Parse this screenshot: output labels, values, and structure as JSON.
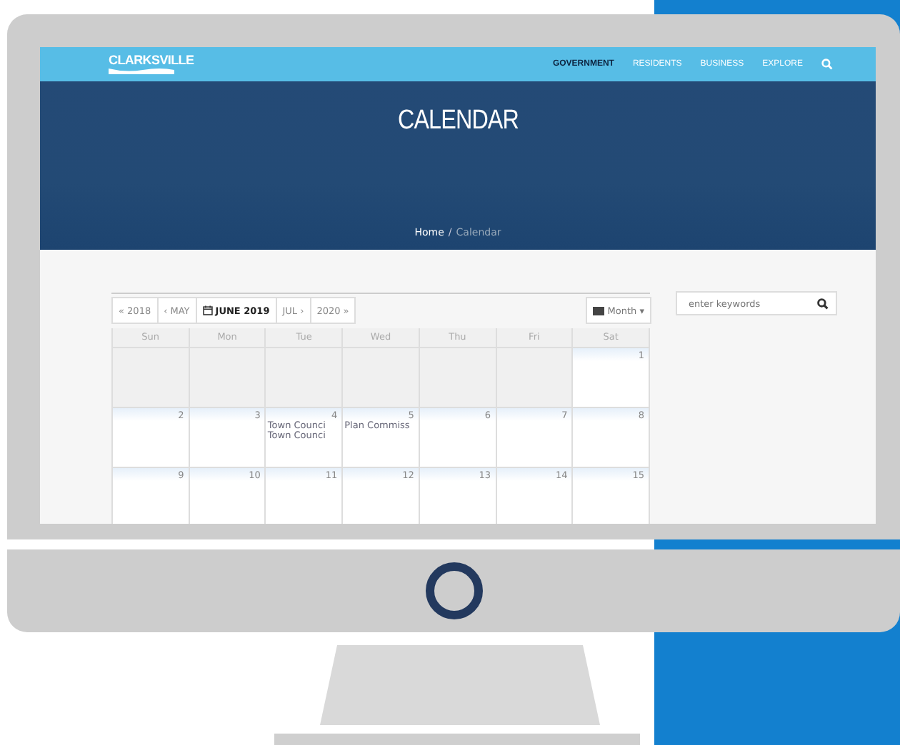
{
  "site": {
    "logo": "CLARKSVILLE",
    "nav": [
      {
        "label": "GOVERNMENT",
        "selected": true
      },
      {
        "label": "RESIDENTS",
        "selected": false
      },
      {
        "label": "BUSINESS",
        "selected": false
      },
      {
        "label": "EXPLORE",
        "selected": false
      }
    ]
  },
  "hero": {
    "title": "CALENDAR",
    "breadcrumb": {
      "home": "Home",
      "separator": "/",
      "current": "Calendar"
    }
  },
  "calendar": {
    "nav_buttons": [
      {
        "label": "« 2018",
        "current": false
      },
      {
        "label": "‹ MAY",
        "current": false
      },
      {
        "label": "JUNE 2019",
        "current": true
      },
      {
        "label": "JUL ›",
        "current": false
      },
      {
        "label": "2020 »",
        "current": false
      }
    ],
    "view": "Month ▾",
    "weekdays": [
      "Sun",
      "Mon",
      "Tue",
      "Wed",
      "Thu",
      "Fri",
      "Sat"
    ],
    "weeks": [
      [
        {
          "outside": true
        },
        {
          "outside": true
        },
        {
          "outside": true
        },
        {
          "outside": true
        },
        {
          "outside": true
        },
        {
          "outside": true
        },
        {
          "day": "1",
          "outside": false
        }
      ],
      [
        {
          "day": "2",
          "outside": false
        },
        {
          "day": "3",
          "outside": false
        },
        {
          "day": "4",
          "outside": false,
          "events": [
            "Town Counci",
            "Town Counci"
          ]
        },
        {
          "day": "5",
          "outside": false,
          "events": [
            "Plan Commiss"
          ]
        },
        {
          "day": "6",
          "outside": false
        },
        {
          "day": "7",
          "outside": false
        },
        {
          "day": "8",
          "outside": false
        }
      ],
      [
        {
          "day": "9",
          "outside": false
        },
        {
          "day": "10",
          "outside": false
        },
        {
          "day": "11",
          "outside": false
        },
        {
          "day": "12",
          "outside": false
        },
        {
          "day": "13",
          "outside": false
        },
        {
          "day": "14",
          "outside": false
        },
        {
          "day": "15",
          "outside": false
        }
      ]
    ]
  },
  "search": {
    "placeholder": "enter keywords"
  }
}
